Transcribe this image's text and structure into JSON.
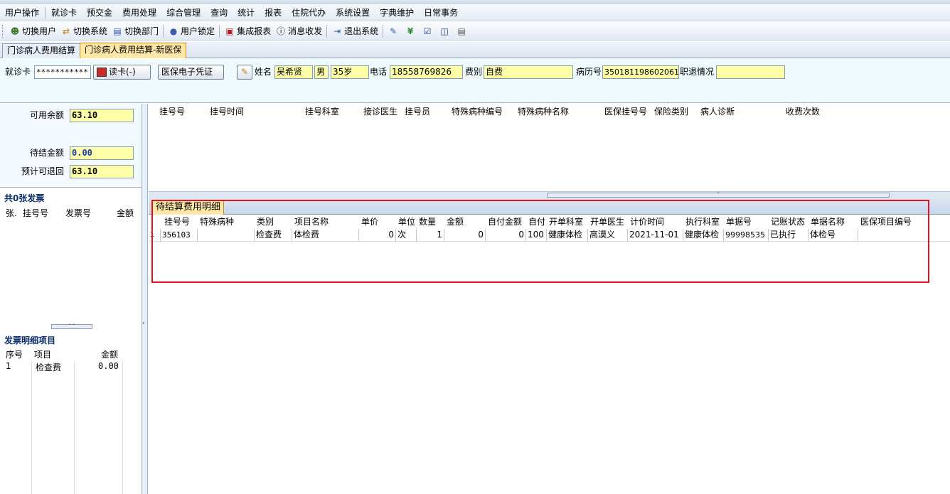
{
  "menu": [
    "用户操作",
    "就诊卡",
    "预交金",
    "费用处理",
    "综合管理",
    "查询",
    "统计",
    "报表",
    "住院代办",
    "系统设置",
    "字典维护",
    "日常事务"
  ],
  "toolbar": {
    "switch_user": "切换用户",
    "switch_system": "切换系统",
    "switch_dept": "切换部门",
    "lock_user": "用户锁定",
    "integrated_report": "集成报表",
    "message": "消息收发",
    "exit": "退出系统"
  },
  "tabs": [
    "门诊病人费用结算",
    "门诊病人费用结算-新医保"
  ],
  "patient": {
    "card_label": "就诊卡",
    "card_value": "***********",
    "read_card": "读卡(-)",
    "ecert": "医保电子凭证",
    "name_label": "姓名",
    "name": "吴希贤",
    "gender": "男",
    "age": "35岁",
    "phone_label": "电话",
    "phone": "18558769826",
    "feetype_label": "费别",
    "feetype": "自费",
    "record_label": "病历号",
    "record_no": "350181198602061",
    "retire_label": "职退情况",
    "retire_value": ""
  },
  "balance": {
    "available_label": "可用余额",
    "available": "63.10",
    "pending_label": "待结金额",
    "pending": "0.00",
    "refund_label": "预计可退回",
    "refund": "63.10"
  },
  "invoices": {
    "title": "共0张发票",
    "columns": [
      "张.",
      "挂号号",
      "发票号",
      "金额"
    ]
  },
  "invoice_detail": {
    "title": "发票明细项目",
    "columns": [
      "序号",
      "项目",
      "金额"
    ],
    "rows": [
      {
        "seq": "1",
        "item": "检查费",
        "amount": "0.00"
      }
    ]
  },
  "registration": {
    "columns": [
      "挂号号",
      "挂号时间",
      "挂号科室",
      "接诊医生",
      "挂号员",
      "特殊病种编号",
      "特殊病种名称",
      "医保挂号号",
      "保险类别",
      "病人诊断",
      "收费次数"
    ]
  },
  "pending_detail": {
    "tab": "待结算费用明细",
    "columns": [
      "挂号号",
      "特殊病种",
      "类别",
      "项目名称",
      "单价",
      "单位",
      "数量",
      "金额",
      "自付金额",
      "自付",
      "开单科室",
      "开单医生",
      "计价时间",
      "执行科室",
      "单据号",
      "记账状态",
      "单据名称",
      "医保项目编号"
    ],
    "rows": [
      {
        "idx": "1",
        "reg_no": "356103",
        "special": "",
        "category": "检查费",
        "item": "体检费",
        "price": "0",
        "unit": "次",
        "qty": "1",
        "amount": "0",
        "self_amount": "0",
        "self_pct": "100",
        "dept": "健康体检",
        "doctor": "高漠义",
        "time": "2021-11-01",
        "exec_dept": "健康体检",
        "doc_no": "99998535",
        "status": "已执行",
        "doc_name": "体检号",
        "insurance_code": ""
      }
    ]
  }
}
